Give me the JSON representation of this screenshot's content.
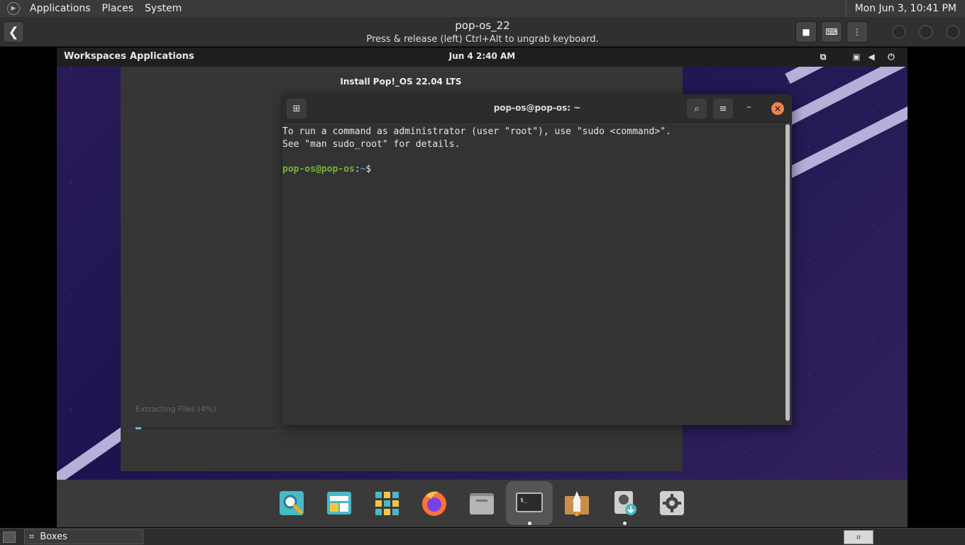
{
  "host_panel": {
    "menus": [
      "Applications",
      "Places",
      "System"
    ],
    "clock": "Mon Jun  3, 10:41 PM"
  },
  "boxes": {
    "vm_name": "pop-os_22",
    "subtitle": "Press & release (left) Ctrl+Alt to ungrab keyboard."
  },
  "guest_panel": {
    "workspaces": "Workspaces",
    "applications": "Applications",
    "clock": "Jun 4   2:40 AM"
  },
  "installer": {
    "title": "Install Pop!_OS 22.04 LTS",
    "status": "Extracting Files (4%)",
    "progress": 0.04
  },
  "terminal": {
    "title": "pop-os@pop-os: ~",
    "line1": "To run a command as administrator (user \"root\"), use \"sudo <command>\".",
    "line2": "See \"man sudo_root\" for details.",
    "prompt_user": "pop-os@pop-os",
    "prompt_sep": ":",
    "prompt_path": "~",
    "prompt_symbol": "$"
  },
  "dock": {
    "items": [
      "search-launcher",
      "pop-shop-store",
      "app-grid",
      "firefox",
      "files",
      "terminal",
      "installer-rocket",
      "disk-installer",
      "settings"
    ],
    "active": "terminal"
  },
  "taskbar": {
    "window_label": "Boxes"
  },
  "colors": {
    "prompt_user": "#73b23a",
    "prompt_path": "#5a8fcf",
    "progress": "#59c3d0",
    "close_button": "#f0824a"
  }
}
